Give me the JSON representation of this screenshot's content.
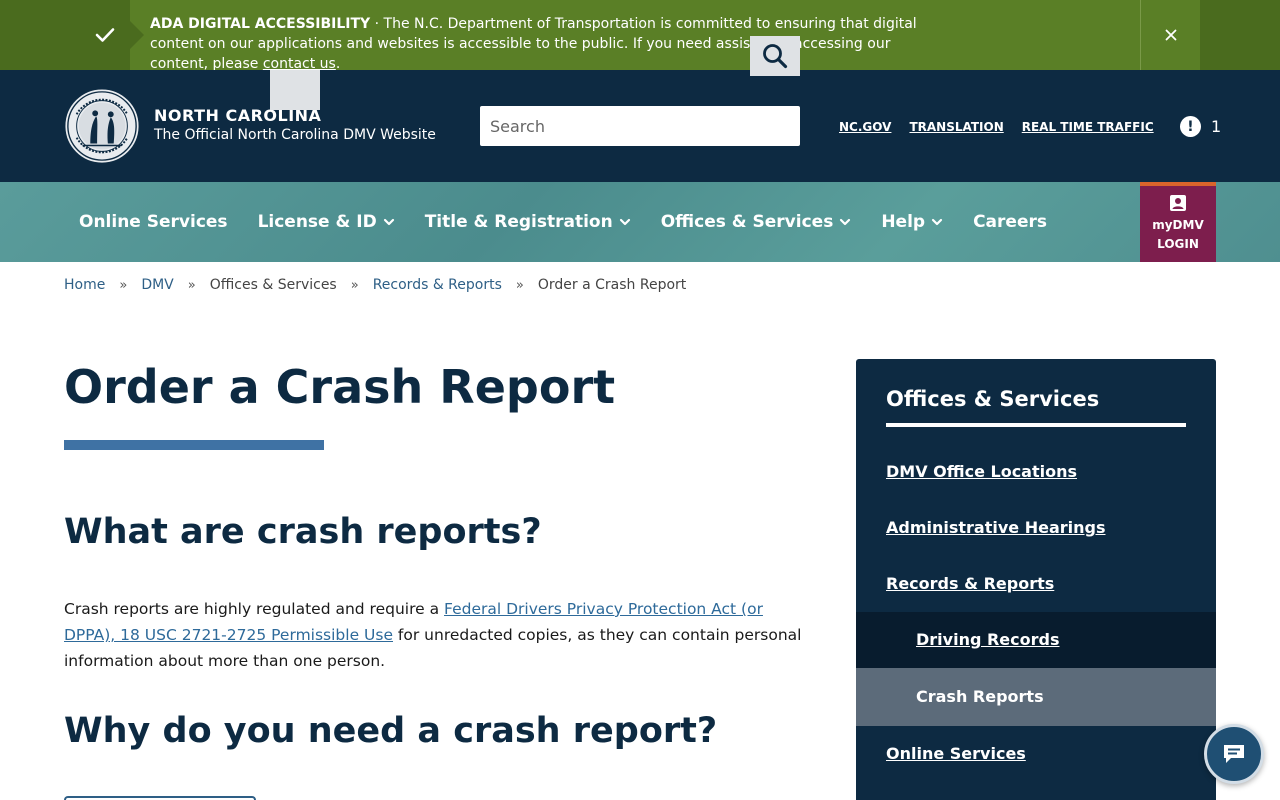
{
  "alert": {
    "title": "ADA DIGITAL ACCESSIBILITY",
    "separator": " · ",
    "body": "The N.C. Department of Transportation is committed to ensuring that digital content on our applications and websites is accessible to the public. If you need assistance accessing our content, please ",
    "link": "contact us",
    "end": "."
  },
  "header": {
    "title": "NORTH CAROLINA",
    "subtitle": "The Official North Carolina DMV Website",
    "search_placeholder": "Search",
    "util_links": [
      "NC.GOV",
      "TRANSLATION",
      "REAL TIME TRAFFIC"
    ],
    "notice_count": "1",
    "notice_icon": "!"
  },
  "nav": {
    "items": [
      {
        "label": "Online Services",
        "dropdown": false
      },
      {
        "label": "License & ID",
        "dropdown": true
      },
      {
        "label": "Title & Registration",
        "dropdown": true
      },
      {
        "label": "Offices & Services",
        "dropdown": true
      },
      {
        "label": "Help",
        "dropdown": true
      },
      {
        "label": "Careers",
        "dropdown": false
      }
    ],
    "mydmv_line1": "myDMV",
    "mydmv_line2": "LOGIN"
  },
  "breadcrumb": {
    "items": [
      "Home",
      "DMV",
      "Offices & Services",
      "Records & Reports"
    ],
    "separator": "»",
    "current": "Order a Crash Report"
  },
  "main": {
    "title": "Order a Crash Report",
    "h2_a": "What are crash reports?",
    "para_start": "Crash reports are highly regulated and require a ",
    "para_link": "Federal Drivers Privacy Protection Act (or DPPA), 18 USC 2721-2725 Permissible Use",
    "para_end": " for unredacted copies, as they can contain personal information about more than one person.",
    "h2_b": "Why do you need a crash report?"
  },
  "sidebar": {
    "heading": "Offices & Services",
    "links": [
      "DMV Office Locations",
      "Administrative Hearings",
      "Records & Reports"
    ],
    "sub_links": [
      "Driving Records",
      "Crash Reports"
    ],
    "bottom_link": "Online Services"
  },
  "colors": {
    "alert_green": "#5a7f26",
    "header_navy": "#0d2a42",
    "nav_teal": "#4b8c8d",
    "mydmv_maroon": "#7d1e4d",
    "accent_blue": "#3f72a4"
  },
  "icons": {
    "alert": "check-icon",
    "close": "close-icon",
    "search": "search-icon",
    "notice": "exclamation-icon",
    "mydmv": "user-badge-icon",
    "chat": "chat-icon"
  }
}
